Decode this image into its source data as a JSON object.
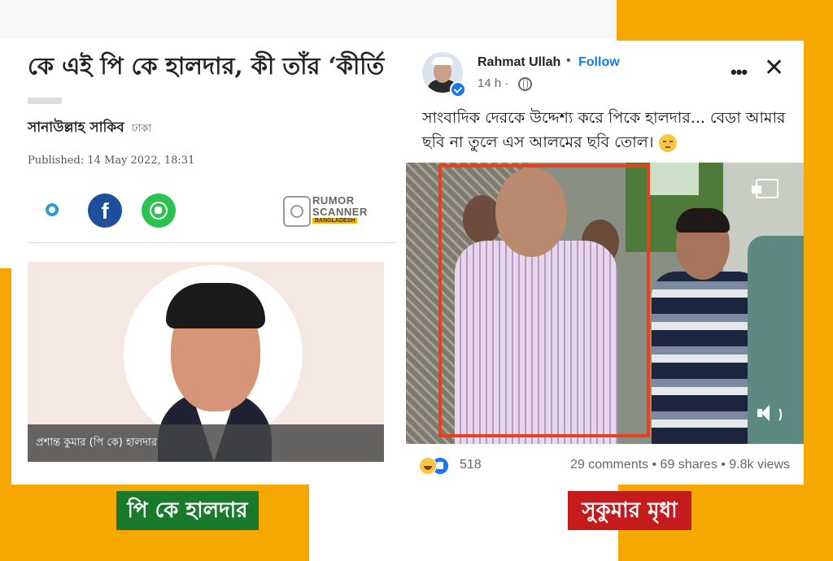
{
  "news": {
    "headline": "কে এই পি কে হালদার, কী তাঁর ‘কীর্তি",
    "author": "সানাউল্লাহ সাকিব",
    "place": "ঢাকা",
    "published": "Published: 14 May 2022, 18:31",
    "share": {
      "facebook_glyph": "f",
      "icons": [
        "twitter-icon",
        "facebook-icon",
        "whatsapp-icon"
      ]
    },
    "watermark": {
      "line1": "RUMOR",
      "line2": "SCANNER",
      "line3": "BANGLADESH"
    },
    "photo_caption": "প্রশান্ত কুমার (পি কে) হালদার"
  },
  "labels": {
    "left": "পি কে হালদার",
    "right": "সুকুমার মৃধা"
  },
  "post": {
    "author": "Rahmat Ullah",
    "separator": "•",
    "follow": "Follow",
    "time": "14 h ·",
    "text": "সাংবাদিক দেরকে উদ্দেশ্য করে পিকে হালদার... বেডা আমার ছবি না তুলে এস আলমের ছবি তোল।",
    "more_glyph": "•••",
    "close_glyph": "✕",
    "reactions_count": "518",
    "stats": "29 comments • 69 shares • 9.8k views"
  },
  "colors": {
    "accent_orange": "#f6a800",
    "facebook_blue": "#1877f2",
    "label_green": "#1a7a2c",
    "label_red": "#c41c1c",
    "highlight_box": "#e8401c"
  }
}
